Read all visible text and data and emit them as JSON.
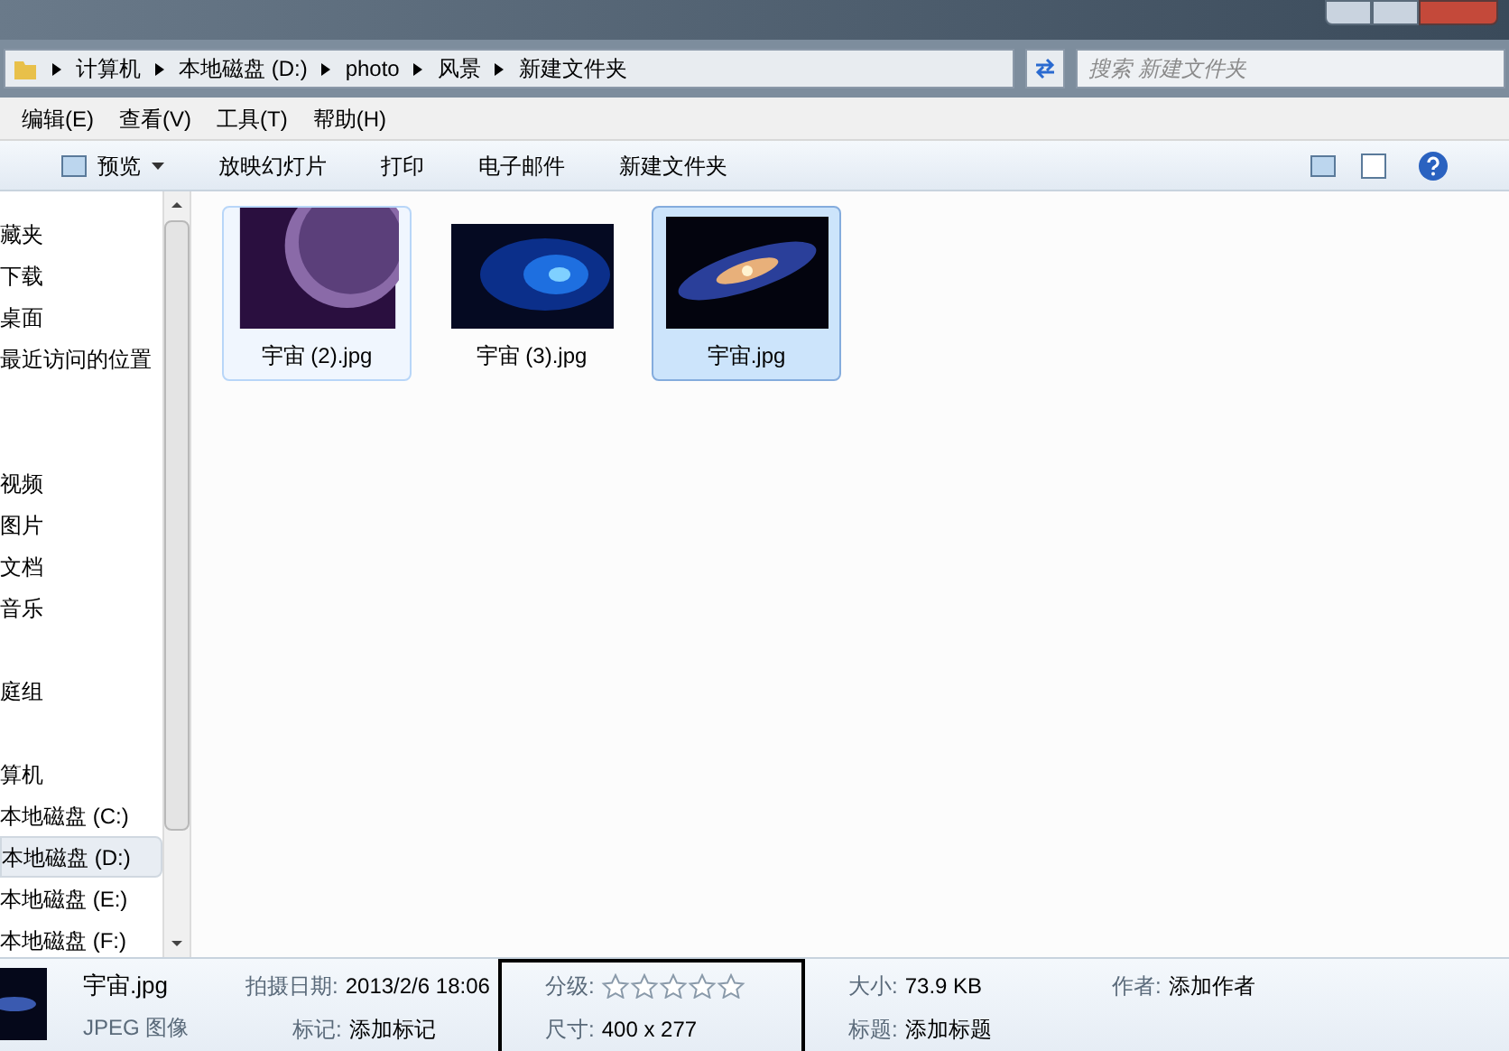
{
  "address_bar": {
    "crumbs": [
      "计算机",
      "本地磁盘 (D:)",
      "photo",
      "风景",
      "新建文件夹"
    ]
  },
  "search": {
    "placeholder": "搜索 新建文件夹"
  },
  "menu": [
    "编辑(E)",
    "查看(V)",
    "工具(T)",
    "帮助(H)"
  ],
  "toolbar": [
    {
      "label": "预览",
      "kind": "dropdown"
    },
    {
      "label": "放映幻灯片",
      "kind": "plain"
    },
    {
      "label": "打印",
      "kind": "plain"
    },
    {
      "label": "电子邮件",
      "kind": "plain"
    },
    {
      "label": "新建文件夹",
      "kind": "plain"
    }
  ],
  "sidebar": {
    "groups": [
      {
        "header": "藏夹",
        "selected": false,
        "children": [
          {
            "label": "下载",
            "selected": false
          },
          {
            "label": "桌面",
            "selected": false
          },
          {
            "label": "最近访问的位置",
            "selected": false
          }
        ]
      },
      {
        "children": [
          {
            "label": "视频",
            "selected": false
          },
          {
            "label": "图片",
            "selected": false
          },
          {
            "label": "文档",
            "selected": false
          },
          {
            "label": "音乐",
            "selected": false
          }
        ]
      },
      {
        "header": "庭组",
        "selected": false
      },
      {
        "header": "算机",
        "selected": false,
        "children": [
          {
            "label": "本地磁盘 (C:)",
            "selected": false
          },
          {
            "label": "本地磁盘 (D:)",
            "selected": true
          },
          {
            "label": "本地磁盘 (E:)",
            "selected": false
          },
          {
            "label": "本地磁盘 (F:)",
            "selected": false
          }
        ]
      }
    ]
  },
  "files": [
    {
      "name": "宇宙 (2).jpg",
      "selected": false,
      "hover": true,
      "kind": "planet"
    },
    {
      "name": "宇宙 (3).jpg",
      "selected": false,
      "hover": false,
      "kind": "spiral"
    },
    {
      "name": "宇宙.jpg",
      "selected": true,
      "hover": false,
      "kind": "galaxy"
    }
  ],
  "details": {
    "name": "宇宙.jpg",
    "type": "JPEG 图像",
    "date_label": "拍摄日期:",
    "date": "2013/2/6 18:06",
    "tags_label": "标记:",
    "tags": "添加标记",
    "rating_label": "分级:",
    "stars": 0,
    "dims_label": "尺寸:",
    "dims": "400 x 277",
    "size_label": "大小:",
    "size": "73.9 KB",
    "title_label": "标题:",
    "title": "添加标题",
    "author_label": "作者:",
    "author": "添加作者"
  }
}
